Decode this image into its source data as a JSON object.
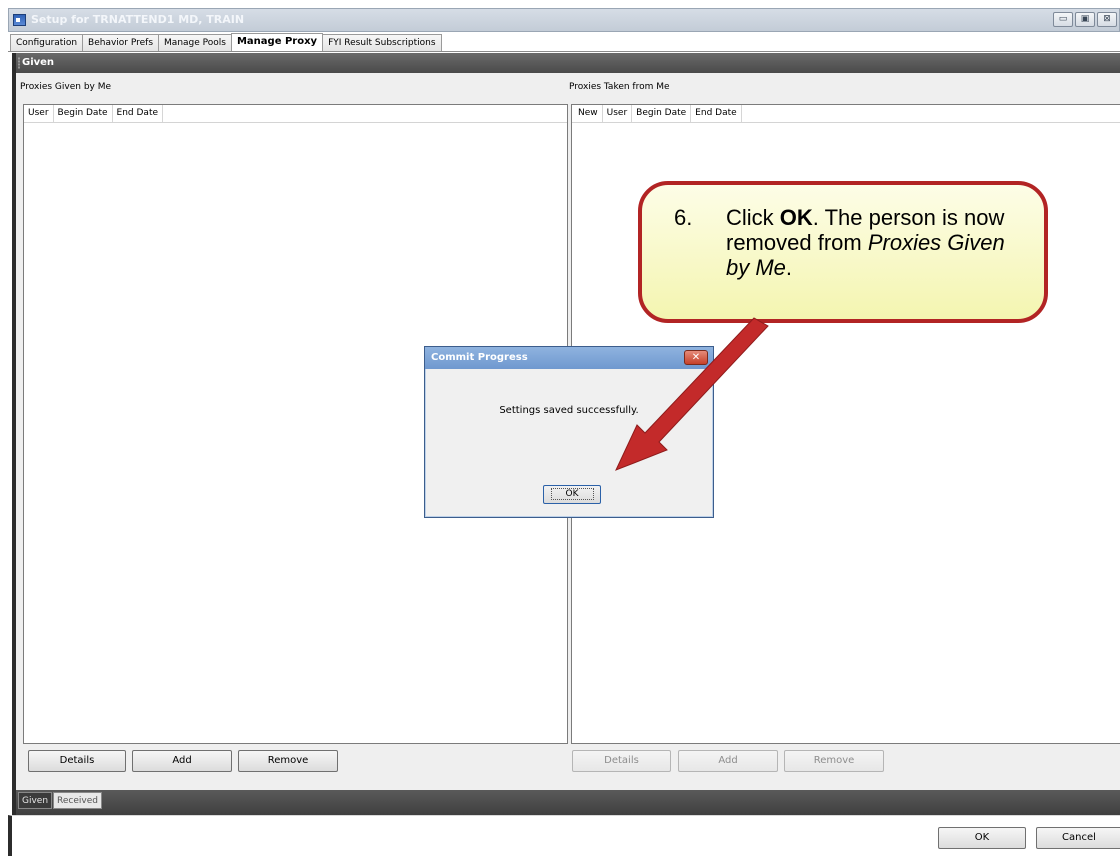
{
  "window": {
    "title": "Setup for TRNATTEND1 MD, TRAIN",
    "controls": {
      "minimize": "▭",
      "maximize": "▣",
      "close": "⊠"
    }
  },
  "tabs": [
    {
      "label": "Configuration"
    },
    {
      "label": "Behavior Prefs"
    },
    {
      "label": "Manage Pools"
    },
    {
      "label": "Manage Proxy"
    },
    {
      "label": "FYI Result Subscriptions"
    }
  ],
  "section": {
    "title": "Given"
  },
  "left_panel": {
    "label": "Proxies Given by Me",
    "columns": [
      "User",
      "Begin Date",
      "End Date"
    ],
    "buttons": {
      "details": "Details",
      "add": "Add",
      "remove": "Remove"
    }
  },
  "right_panel": {
    "label": "Proxies Taken from Me",
    "columns": [
      "New",
      "User",
      "Begin Date",
      "End Date"
    ],
    "buttons": {
      "details": "Details",
      "add": "Add",
      "remove": "Remove"
    }
  },
  "bottom_tabs": [
    {
      "label": "Given"
    },
    {
      "label": "Received"
    }
  ],
  "footer": {
    "ok": "OK",
    "cancel": "Cancel"
  },
  "dialog": {
    "title": "Commit Progress",
    "close": "✕",
    "message": "Settings saved successfully.",
    "ok": "OK"
  },
  "callout": {
    "number": "6.",
    "text_before": "Click ",
    "bold": "OK",
    "text_mid": ".  The person is now removed from ",
    "italic": "Proxies Given by Me",
    "text_end": "."
  },
  "colors": {
    "callout_border": "#b22424",
    "callout_fill": "#f8f8c8",
    "arrow": "#c32a2a"
  }
}
